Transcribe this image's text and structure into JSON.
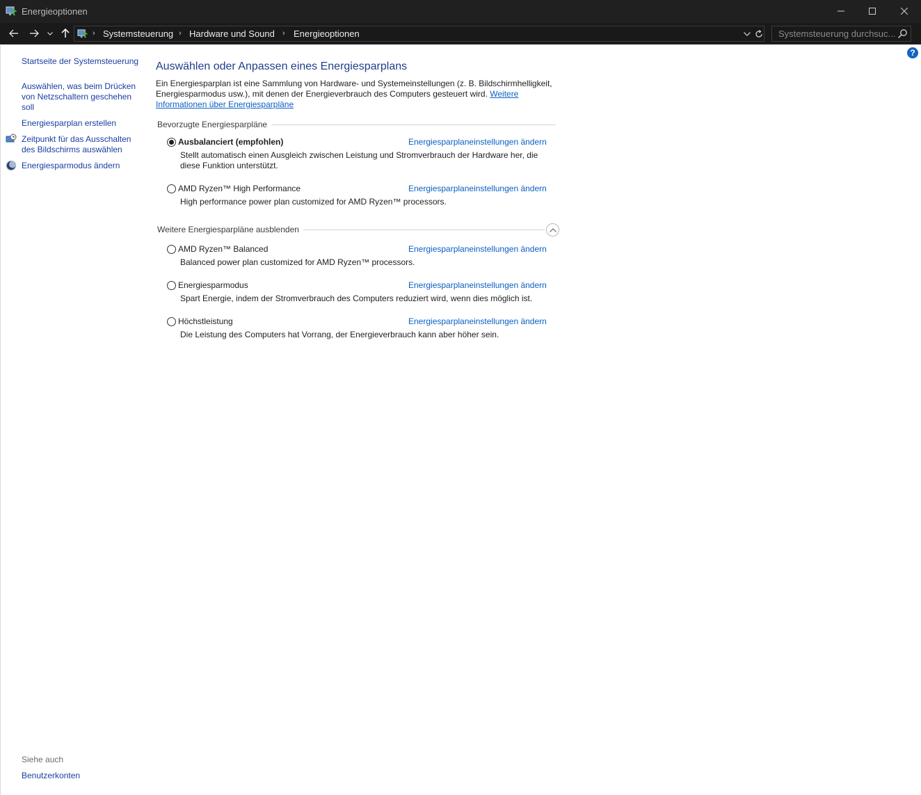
{
  "window": {
    "title": "Energieoptionen"
  },
  "navigation": {
    "breadcrumbs": [
      "Systemsteuerung",
      "Hardware und Sound",
      "Energieoptionen"
    ],
    "search_placeholder": "Systemsteuerung durchsuc..."
  },
  "sidebar": {
    "links": [
      {
        "label": "Startseite der Systemsteuerung"
      },
      {
        "label": "Auswählen, was beim Drücken von Netzschaltern geschehen soll"
      },
      {
        "label": "Energiesparplan erstellen"
      },
      {
        "label": "Zeitpunkt für das Ausschalten des Bildschirms auswählen",
        "icon": "clock-monitor-icon"
      },
      {
        "label": "Energiesparmodus ändern",
        "icon": "moon-icon"
      }
    ],
    "see_also_label": "Siehe auch",
    "see_also_links": [
      "Benutzerkonten"
    ]
  },
  "main": {
    "help_label": "?",
    "title": "Auswählen oder Anpassen eines Energiesparplans",
    "intro_text": "Ein Energiesparplan ist eine Sammlung von Hardware- und Systemeinstellungen (z. B. Bildschirmhelligkeit, Energiesparmodus usw.), mit denen der Energieverbrauch des Computers gesteuert wird. ",
    "intro_link": "Weitere Informationen über Energiesparpläne",
    "preferred_header": "Bevorzugte Energiesparpläne",
    "more_header": "Weitere Energiesparpläne ausblenden",
    "change_link_label": "Energiesparplaneinstellungen ändern",
    "preferred_plans": [
      {
        "name": "Ausbalanciert (empfohlen)",
        "selected": true,
        "description": "Stellt automatisch einen Ausgleich zwischen Leistung und Stromverbrauch der Hardware her, die diese Funktion unterstützt."
      },
      {
        "name": "AMD Ryzen™ High Performance",
        "selected": false,
        "description": "High performance power plan customized for AMD Ryzen™ processors."
      }
    ],
    "more_plans": [
      {
        "name": "AMD Ryzen™ Balanced",
        "selected": false,
        "description": "Balanced power plan customized for AMD Ryzen™ processors."
      },
      {
        "name": "Energiesparmodus",
        "selected": false,
        "description": "Spart Energie, indem der Stromverbrauch des Computers reduziert wird, wenn dies möglich ist."
      },
      {
        "name": "Höchstleistung",
        "selected": false,
        "description": "Die Leistung des Computers hat Vorrang, der Energieverbrauch kann aber höher sein."
      }
    ]
  },
  "colors": {
    "titlebar_bg": "#202020",
    "link_blue": "#0b5fc4",
    "heading_blue": "#1f3f8a"
  }
}
